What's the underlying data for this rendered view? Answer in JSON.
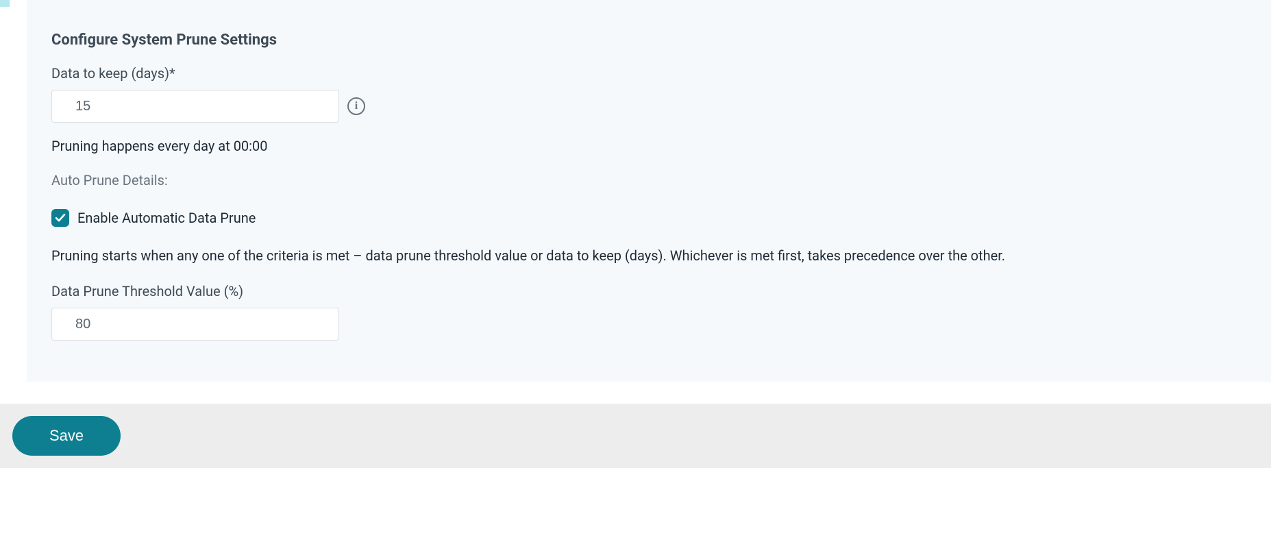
{
  "panel": {
    "title": "Configure System Prune Settings",
    "data_to_keep_label": "Data to keep (days)*",
    "data_to_keep_value": "15",
    "schedule_text": "Pruning happens every day at 00:00",
    "auto_prune_subtitle": "Auto Prune Details:",
    "enable_checkbox_label": "Enable Automatic Data Prune",
    "enable_checkbox_checked": true,
    "explain_text": "Pruning starts when any one of the criteria is met – data prune threshold value or data to keep (days). Whichever is met first, takes precedence over the other.",
    "threshold_label": "Data Prune Threshold Value (%)",
    "threshold_value": "80"
  },
  "footer": {
    "save_label": "Save"
  },
  "colors": {
    "accent": "#0d7f91",
    "panel_bg": "#f5f9fc",
    "footer_bg": "#ededed"
  }
}
